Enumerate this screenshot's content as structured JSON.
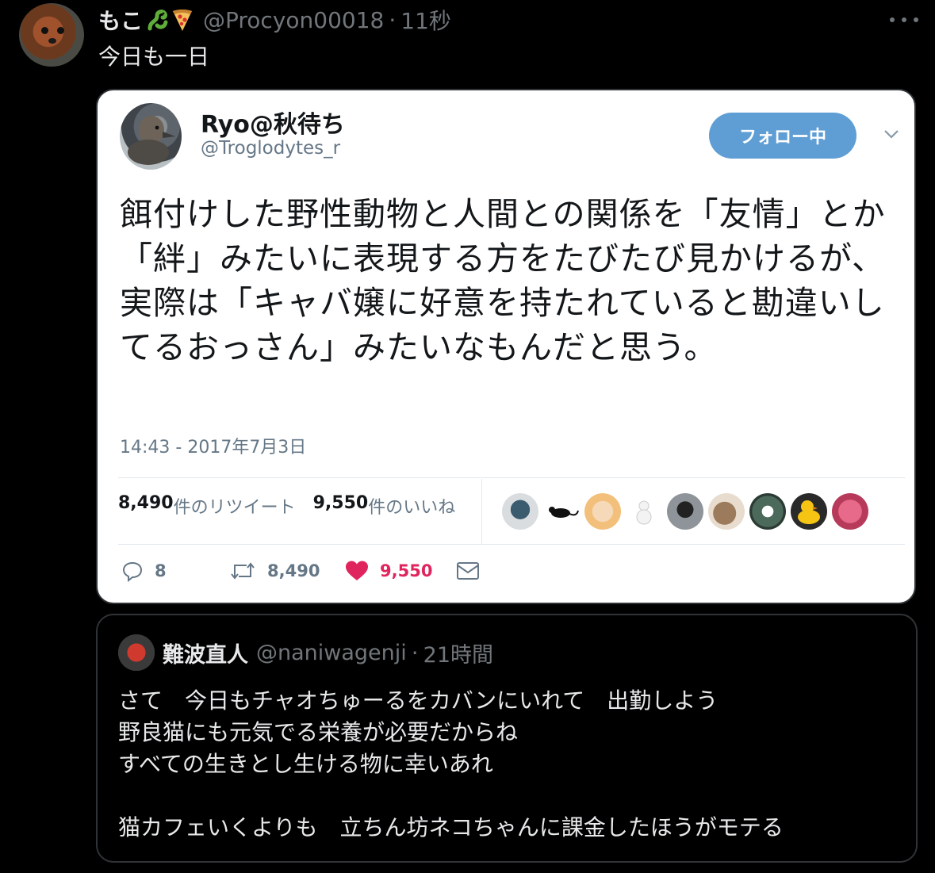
{
  "outer_tweet": {
    "display_name": "もこ",
    "name_emojis": [
      "snake-emoji",
      "pizza-emoji"
    ],
    "handle": "@Procyon00018",
    "separator": "·",
    "time": "11秒",
    "text": "今日も一日"
  },
  "embedded_tweet": {
    "display_name": "Ryo@秋待ち",
    "handle": "@Troglodytes_r",
    "follow_label": "フォロー中",
    "text": "餌付けした野性動物と人間との関係を「友情」とか「絆」みたいに表現する方をたびたび見かけるが、実際は「キャバ嬢に好意を持たれていると勘違いしてるおっさん」みたいなもんだと思う。",
    "timestamp": "14:43 - 2017年7月3日",
    "retweets_count": "8,490",
    "retweets_label": "件のリツイート",
    "likes_count": "9,550",
    "likes_label": "件のいいね",
    "actions": {
      "replies": "8",
      "retweets": "8,490",
      "likes": "9,550"
    },
    "accent_color": "#5f9ed4",
    "like_color": "#e0245e"
  },
  "quoted_tweet": {
    "display_name": "難波直人",
    "handle": "@naniwagenji",
    "separator": "·",
    "time": "21時間",
    "text": "さて　今日もチャオちゅーるをカバンにいれて　出勤しよう\n野良猫にも元気でる栄養が必要だからね\nすべての生きとし生ける物に幸いあれ\n\n猫カフェいくよりも　立ちん坊ネコちゃんに課金したほうがモテる"
  }
}
